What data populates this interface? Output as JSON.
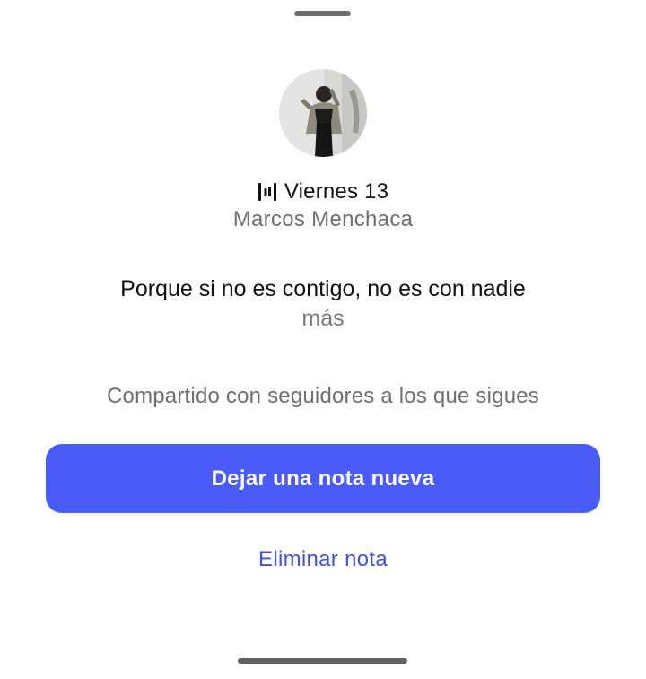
{
  "note": {
    "song_title": "Viernes 13",
    "song_icon": "music-bars-icon",
    "artist": "Marcos Menchaca",
    "text": "Porque si no es contigo, no es con nadie",
    "more_label": "más",
    "shared_info": "Compartido con seguidores a los que sigues"
  },
  "actions": {
    "new_note_label": "Dejar una nota nueva",
    "delete_label": "Eliminar nota"
  },
  "colors": {
    "primary_button": "#4a5cf8",
    "link": "#4450e0",
    "secondary_text": "#6c7074"
  }
}
